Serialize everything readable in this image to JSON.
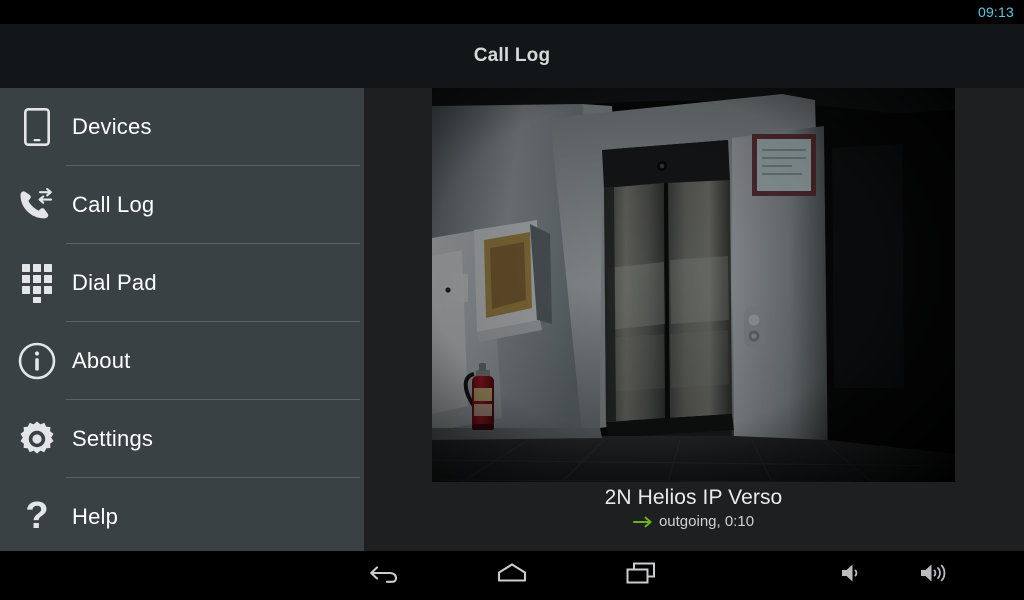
{
  "status_bar": {
    "clock": "09:13"
  },
  "title_bar": {
    "title": "Call Log"
  },
  "sidebar": {
    "items": [
      {
        "label": "Devices",
        "icon": "smartphone-icon"
      },
      {
        "label": "Call Log",
        "icon": "call-log-icon"
      },
      {
        "label": "Dial Pad",
        "icon": "dialpad-icon"
      },
      {
        "label": "About",
        "icon": "info-icon"
      },
      {
        "label": "Settings",
        "icon": "gear-icon"
      },
      {
        "label": "Help",
        "icon": "question-mark-icon"
      }
    ]
  },
  "content": {
    "call_entry": {
      "device_name": "2N Helios IP Verso",
      "direction_arrow": "→",
      "details": "outgoing, 0:10",
      "snapshot_alt": "elevator-lobby-camera-snapshot"
    }
  },
  "navbar": {
    "buttons": [
      {
        "name": "back-button",
        "icon": "back-arrow-icon"
      },
      {
        "name": "home-button",
        "icon": "home-icon"
      },
      {
        "name": "recents-button",
        "icon": "recents-icon"
      },
      {
        "name": "volume-down-button",
        "icon": "volume-down-icon"
      },
      {
        "name": "volume-up-button",
        "icon": "volume-up-icon"
      }
    ]
  },
  "colors": {
    "status_clock": "#5cc8e8",
    "sidebar_bg": "#3a4145",
    "title_bar_bg": "#131618",
    "content_bg": "#1e1f21",
    "navbar_bg": "#000000",
    "outgoing_arrow": "#6ab023"
  }
}
